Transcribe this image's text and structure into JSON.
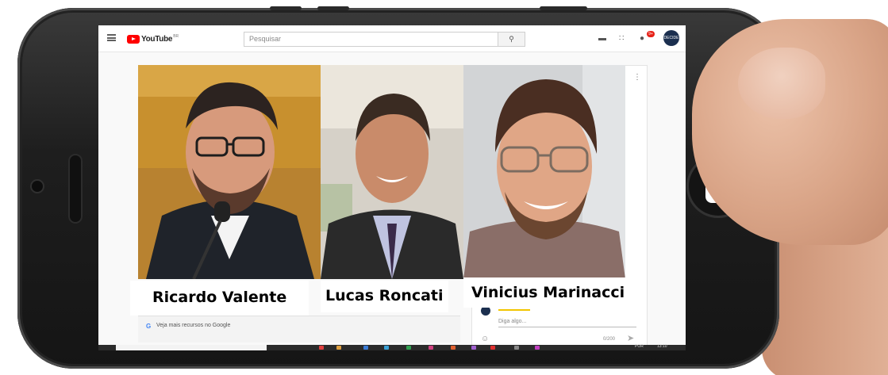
{
  "header": {
    "logo_text": "YouTube",
    "logo_region": "BR",
    "search_placeholder": "Pesquisar",
    "notification_count": "9+",
    "avatar_text": "DECIDE"
  },
  "people": [
    {
      "name": "Ricardo Valente"
    },
    {
      "name": "Lucas Roncati"
    },
    {
      "name": "Vinicius Marinacci"
    }
  ],
  "chat": {
    "placeholder": "Diga algo...",
    "counter": "0/200"
  },
  "google_link": "Veja mais recursos no Google",
  "taskbar": {
    "lang": "POR",
    "time": "13:10"
  },
  "colors": {
    "youtube_red": "#ff0000",
    "notification_red": "#e62117",
    "chat_accent": "#f2c500",
    "avatar_bg": "#1b2f4f"
  }
}
